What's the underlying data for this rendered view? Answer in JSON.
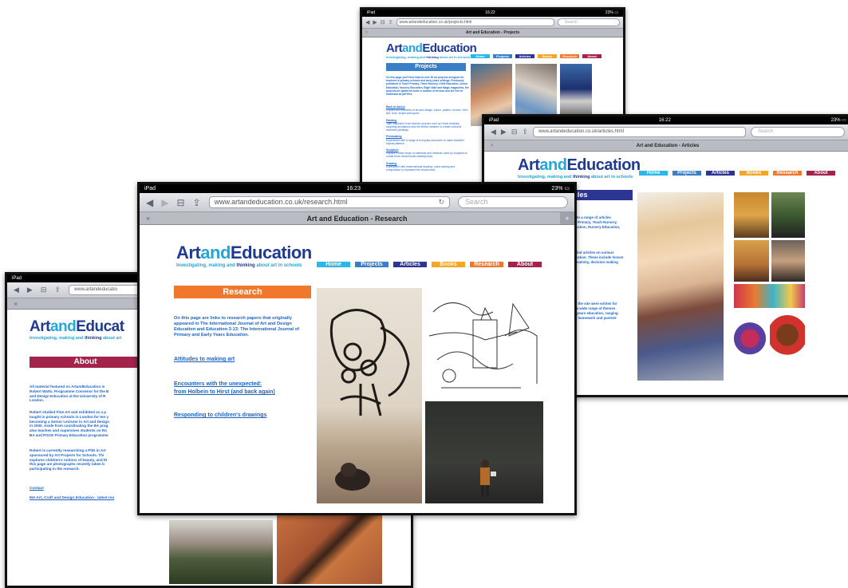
{
  "logo": {
    "part1": "Art",
    "part2": "and",
    "part3": "Education"
  },
  "tagline": {
    "pre": "Investigating, making and ",
    "bold": "thinking",
    "post": " about art in schools"
  },
  "nav": [
    "Home",
    "Projects",
    "Articles",
    "Books",
    "Research",
    "About"
  ],
  "ui_colors": {
    "home": "#29b8e8",
    "projects": "#3a7ec8",
    "articles": "#2c3592",
    "books": "#f5a623",
    "research": "#f0772b",
    "about": "#a3234b"
  },
  "browser": {
    "device": "iPad",
    "search_placeholder": "Search",
    "time": "16:22",
    "time_alt": "16:23",
    "battery": "23% ▭",
    "reader": "Reader"
  },
  "projects_page": {
    "url": "www.artandeducation.co.uk/projects.html",
    "tab_title": "Art and Education - Projects",
    "heading": "Projects",
    "intro": "On this page you'll find links to over 30 art projects designed for teachers in primary schools and early years settings. Previously published in Teach Primary, Teach Nursery, Child Education, Junior Education, Nursery Education, Right Start and Magic magazines, the projects are gathered under a number of themes and are free to download as pdf files.",
    "sections": [
      {
        "title": "Back to basics",
        "text": "Explore the elements of art and design: colour, pattern, texture, form, line, tone, shape and space"
      },
      {
        "title": "Painting",
        "text": "Take inspiration from diverse sources such as Hindu festivals, scuplting animations and the British weather to create colourful inventive paintings"
      },
      {
        "title": "Printmaking",
        "text": "Experiment with a range of everyday resources to make beautiful repeat patterns"
      },
      {
        "title": "Sculpture",
        "text": "Explore a wide range of materials and methods used by sculptors to create three dimensional masterpieces"
      },
      {
        "title": "Drawing",
        "text": "Experiment with observational drawing, mark-making and composition to represent the visual world"
      }
    ]
  },
  "articles_page": {
    "url": "www.artandeducation.co.uk/articles.html",
    "tab_title": "Art and Education - Articles",
    "heading_fragment": "cles",
    "text1": "u to a range of articles\nh, Primary, Teach Nursery,\nucation, Nursery Education,\n",
    "text2": "I find articles on various\nucation. These include lesson\ncreativity, decision making",
    "text3": "of the site were written for\ne a wide range of themes\ny years education, ranging\n to homework and parents'"
  },
  "research_page": {
    "url": "www.artandeducation.co.uk/research.html",
    "tab_title": "Art and Education - Research",
    "heading": "Research",
    "intro": "On this page are links to research papers that originally appeared in The International Journal of Art and Design Education and Education 3-13: The International Journal of Primary and Early Years Education.",
    "links": [
      "Attitudes to making art",
      "Encounters with the unexpected:\nfrom Holbein to Hirst (and back again)",
      "Responding to children's drawings"
    ]
  },
  "about_page": {
    "url": "www.artandeducatio",
    "logo_fragment": "Educat",
    "tagline_fragment": "about art",
    "heading": "About",
    "p1": "All material featured on ArtandEducation is\nRobert Watts, Programme Convenor for the B\nand Design Education at the University of R\nLondon.",
    "p2": "Robert studied Fine Art and exhibited as a p\ntaught in primary schools in London for ten y\nbecoming a Senior Lecturer in Art and Design\nin 2000.  Aside from coordinating the BA prog\nalso teaches and supervises students on Ro\nBA and PGCE Primary Education programme",
    "p3": "Robert is currently researching a PhD in Art\nsponsored by Art Projects for Schools. Thi\nexplores children's notions of beauty, and th\nthis page are photographs recently taken b\nparticipating in the research.",
    "links": [
      "Contact",
      "MA Art, Craft and Design Education - latest res"
    ]
  }
}
